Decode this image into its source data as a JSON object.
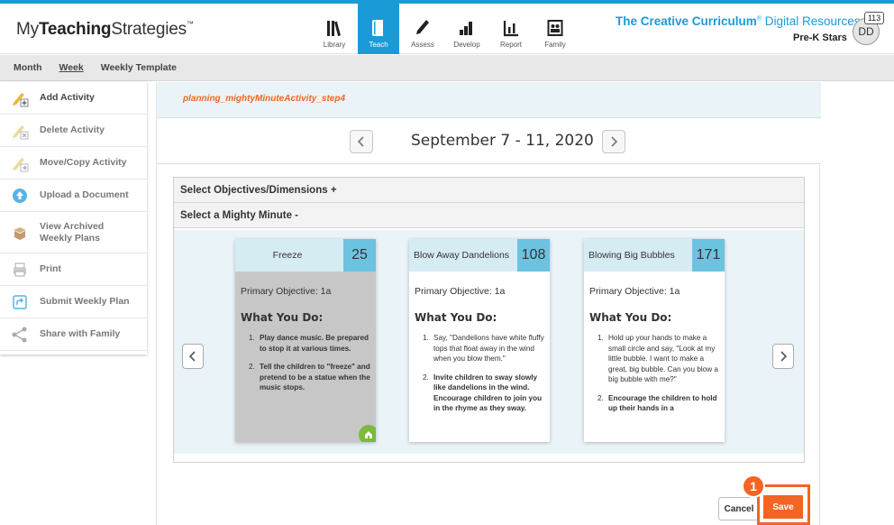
{
  "header": {
    "logo_prefix": "My",
    "logo_bold": "Teaching",
    "logo_suffix": "Strategies",
    "logo_tm": "™",
    "brand_main": "The Creative Curriculum",
    "brand_reg": "®",
    "brand_rest": " Digital Resources",
    "class_name": "Pre-K Stars",
    "avatar_initials": "DD",
    "notification_count": "113",
    "nav": [
      {
        "label": "Library",
        "icon": "library-icon"
      },
      {
        "label": "Teach",
        "icon": "book-icon",
        "active": true
      },
      {
        "label": "Assess",
        "icon": "pencil-icon"
      },
      {
        "label": "Develop",
        "icon": "develop-icon"
      },
      {
        "label": "Report",
        "icon": "report-chart-icon"
      },
      {
        "label": "Family",
        "icon": "family-icon"
      }
    ]
  },
  "subnav": {
    "items": [
      {
        "label": "Month"
      },
      {
        "label": "Week",
        "active": true
      },
      {
        "label": "Weekly Template"
      }
    ]
  },
  "sidebar": {
    "items": [
      {
        "label": "Add Activity",
        "icon": "add-activity-icon"
      },
      {
        "label": "Delete Activity",
        "icon": "delete-activity-icon"
      },
      {
        "label": "Move/Copy Activity",
        "icon": "move-copy-icon"
      },
      {
        "label": "Upload a Document",
        "icon": "upload-icon"
      },
      {
        "label_line1": "View Archived",
        "label_line2": "Weekly Plans",
        "icon": "archive-icon"
      },
      {
        "label": "Print",
        "icon": "print-icon"
      },
      {
        "label": "Submit Weekly Plan",
        "icon": "submit-icon"
      },
      {
        "label": "Share with Family",
        "icon": "share-icon"
      }
    ]
  },
  "main": {
    "step_key": "planning_mightyMinuteActivity_step4",
    "week_title": "September 7 - 11, 2020",
    "accordion_objectives": "Select Objectives/Dimensions +",
    "accordion_mighty": "Select a Mighty Minute -",
    "cards": [
      {
        "title": "Freeze",
        "number": "25",
        "objective": "Primary Objective: 1a",
        "heading": "What You Do:",
        "steps": [
          {
            "n": "1.",
            "text": "Play dance music. Be prepared to stop it at various times."
          },
          {
            "n": "2.",
            "text": "Tell the children to \"freeze\" and pretend to be a statue when the music stops."
          }
        ]
      },
      {
        "title": "Blow Away Dandelions",
        "number": "108",
        "objective": "Primary Objective: 1a",
        "heading": "What You Do:",
        "steps": [
          {
            "n": "1.",
            "text": "Say, \"Dandelions have white fluffy tops that float away in the wind when you blow them.\""
          },
          {
            "n": "2.",
            "text": "Invite children to sway slowly like dandelions in the wind. Encourage children to join you in the rhyme as they sway."
          }
        ]
      },
      {
        "title": "Blowing Big Bubbles",
        "number": "171",
        "objective": "Primary Objective: 1a",
        "heading": "What You Do:",
        "steps": [
          {
            "n": "1.",
            "text": "Hold up your hands to make a small circle and say, \"Look at my little bubble. I want to make a great, big bubble. Can you blow a big bubble with me?\""
          },
          {
            "n": "2.",
            "text": "Encourage the children to hold up their hands in a"
          }
        ]
      }
    ],
    "cancel_label": "Cancel",
    "save_label": "Save",
    "callout_number": "1"
  },
  "colors": {
    "brand_blue": "#1a9bd7",
    "accent_orange": "#f26522",
    "card_number_bg": "#6cc3e0",
    "card_head_bg": "#d6ecf3"
  }
}
